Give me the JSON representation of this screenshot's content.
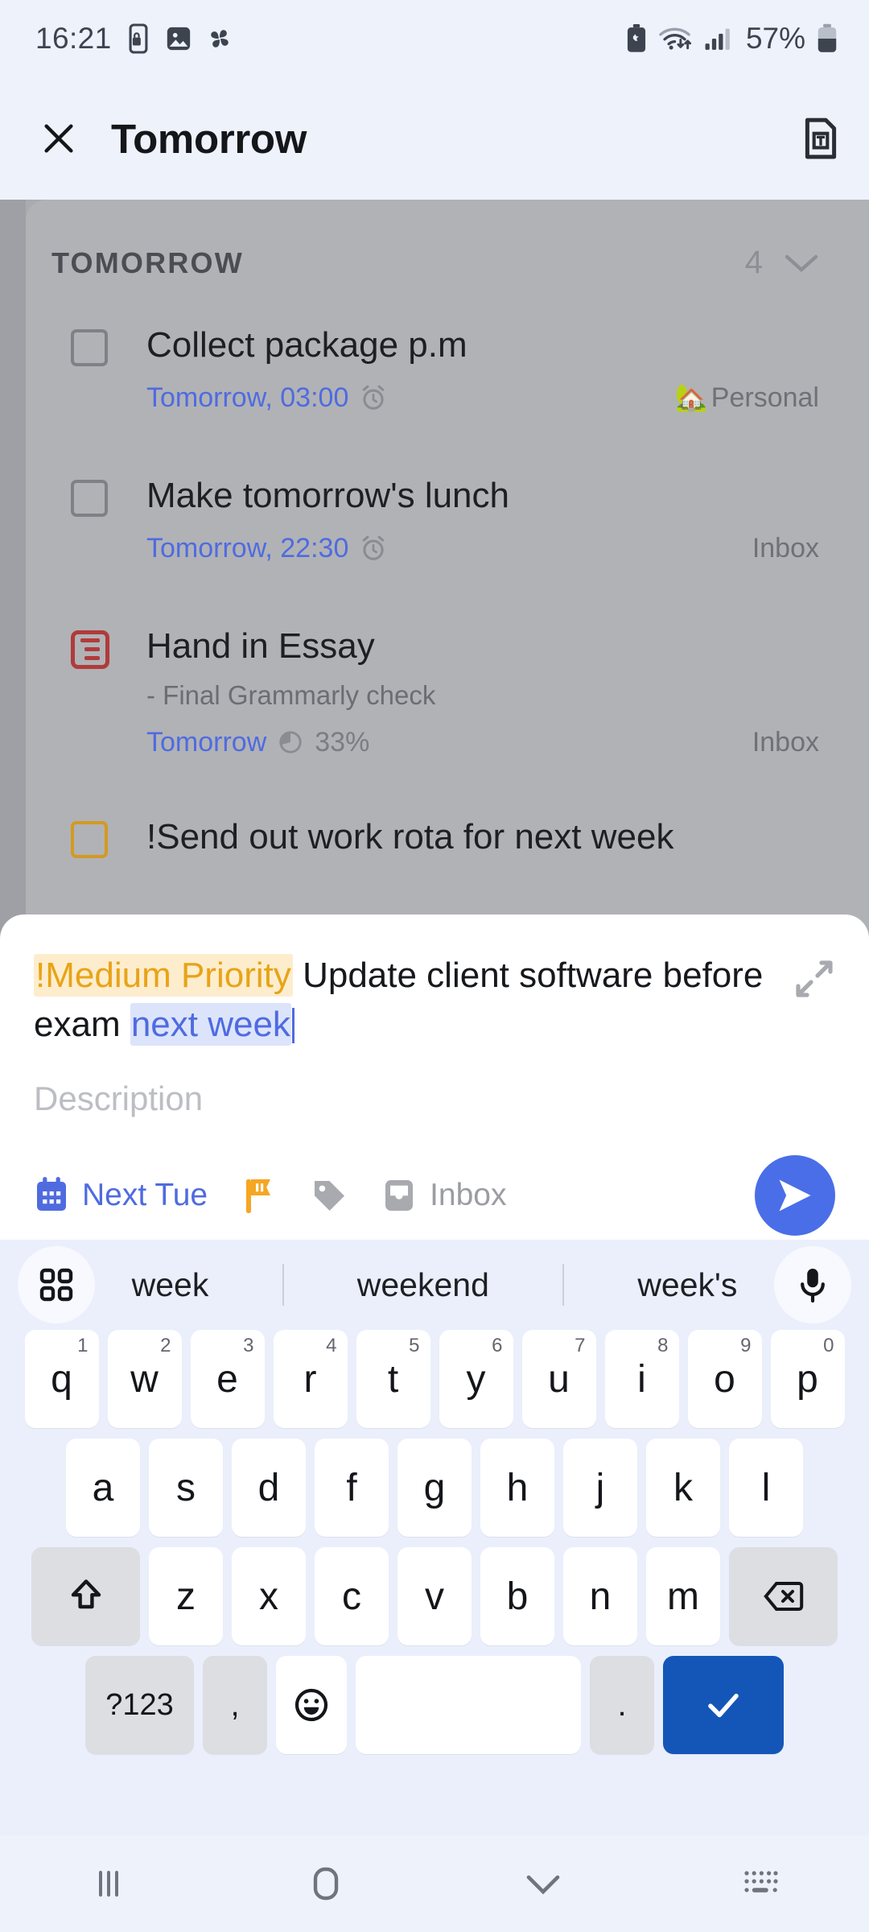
{
  "status_bar": {
    "time": "16:21",
    "battery_percent": "57%",
    "left_icons": [
      "mobile-lock-icon",
      "image-icon",
      "pinwheel-icon"
    ],
    "right_icons": [
      "battery-saver-icon",
      "wifi-icon",
      "signal-icon",
      "battery-icon"
    ]
  },
  "app_bar": {
    "close_label": "close-icon",
    "title": "Tomorrow",
    "template_label": "template-text-icon"
  },
  "task_list": {
    "section_title": "TOMORROW",
    "count": "4",
    "collapse_icon": "chevron-down-icon",
    "tasks": [
      {
        "marker": "checkbox",
        "title": "Collect package p.m",
        "note": "",
        "date": "Tomorrow, 03:00",
        "has_alarm": true,
        "progress": "",
        "project_emoji": "🏡",
        "project": "Personal"
      },
      {
        "marker": "checkbox",
        "title": "Make tomorrow's lunch",
        "note": "",
        "date": "Tomorrow, 22:30",
        "has_alarm": true,
        "progress": "",
        "project_emoji": "",
        "project": "Inbox"
      },
      {
        "marker": "subtask-icon",
        "title": "Hand in Essay",
        "note": "- Final Grammarly check",
        "date": "Tomorrow",
        "has_alarm": false,
        "progress": "33%",
        "project_emoji": "",
        "project": "Inbox"
      },
      {
        "marker": "checkbox-amber",
        "title": "!Send out work rota for next week",
        "note": "",
        "date": "",
        "has_alarm": false,
        "progress": "",
        "project_emoji": "",
        "project": ""
      }
    ]
  },
  "quick_add": {
    "priority_token": "!Medium Priority",
    "text_plain": " Update client software before exam ",
    "date_token": "next week",
    "description_placeholder": "Description",
    "expand_icon": "expand-arrows-icon",
    "date_chip": "Next Tue",
    "priority_icon": "flag-icon",
    "label_icon": "tag-icon",
    "project_icon": "inbox-icon",
    "project_chip": "Inbox",
    "send_icon": "send-icon"
  },
  "keyboard": {
    "suggestion_grid_icon": "keyboard-grid-icon",
    "suggestions": [
      "week",
      "weekend",
      "week's"
    ],
    "mic_icon": "microphone-icon",
    "row1": [
      {
        "key": "q",
        "sup": "1"
      },
      {
        "key": "w",
        "sup": "2"
      },
      {
        "key": "e",
        "sup": "3"
      },
      {
        "key": "r",
        "sup": "4"
      },
      {
        "key": "t",
        "sup": "5"
      },
      {
        "key": "y",
        "sup": "6"
      },
      {
        "key": "u",
        "sup": "7"
      },
      {
        "key": "i",
        "sup": "8"
      },
      {
        "key": "o",
        "sup": "9"
      },
      {
        "key": "p",
        "sup": "0"
      }
    ],
    "row2": [
      "a",
      "s",
      "d",
      "f",
      "g",
      "h",
      "j",
      "k",
      "l"
    ],
    "row3": [
      "z",
      "x",
      "c",
      "v",
      "b",
      "n",
      "m"
    ],
    "shift_icon": "shift-icon",
    "backspace_icon": "backspace-icon",
    "symbols_key": "?123",
    "comma_key": ",",
    "emoji_key": "emoji-icon",
    "space_key": "",
    "period_key": ".",
    "enter_icon": "checkmark-icon"
  },
  "nav_bar": {
    "recents_icon": "recents-icon",
    "home_icon": "home-icon",
    "back_icon": "dismiss-keyboard-icon",
    "keyboard_switch_icon": "keyboard-switch-icon"
  },
  "colors": {
    "screen_bg": "#eef2fb",
    "dim_overlay": "#b1b2b6",
    "accent_blue": "#4f6be0",
    "send_blue": "#4a6ee8",
    "enter_blue": "#1456b8",
    "amber": "#e8a317",
    "red": "#b03b3b"
  }
}
